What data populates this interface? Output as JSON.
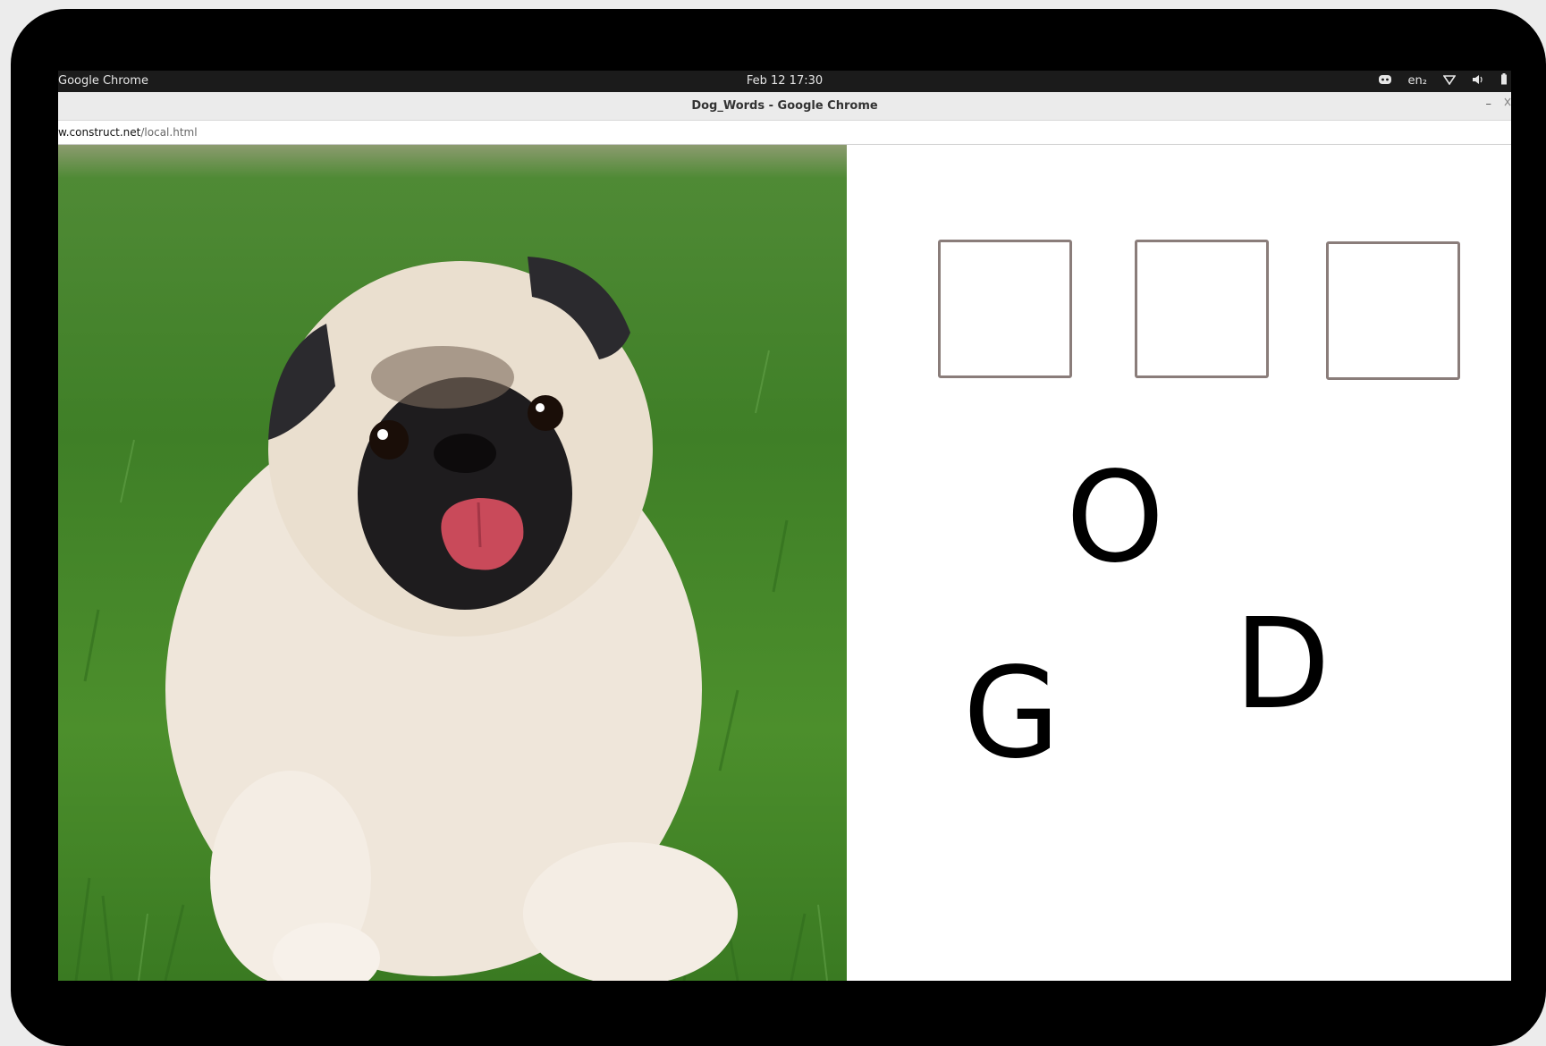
{
  "topbar": {
    "app_name": "Google Chrome",
    "datetime": "Feb 12  17:30",
    "language": "en₂",
    "icons": [
      "discord-icon",
      "wifi-icon",
      "volume-icon",
      "battery-icon"
    ]
  },
  "window": {
    "title": "Dog_Words - Google Chrome",
    "minimize_label": "–"
  },
  "address": {
    "host": "w.construct.net",
    "path": "/local.html"
  },
  "game": {
    "image": "pug-photo",
    "slots_count": 3,
    "letters": [
      "O",
      "G",
      "D"
    ]
  },
  "colors": {
    "slot_border": "#8a7d7a",
    "grass": "#4c8f2c"
  }
}
